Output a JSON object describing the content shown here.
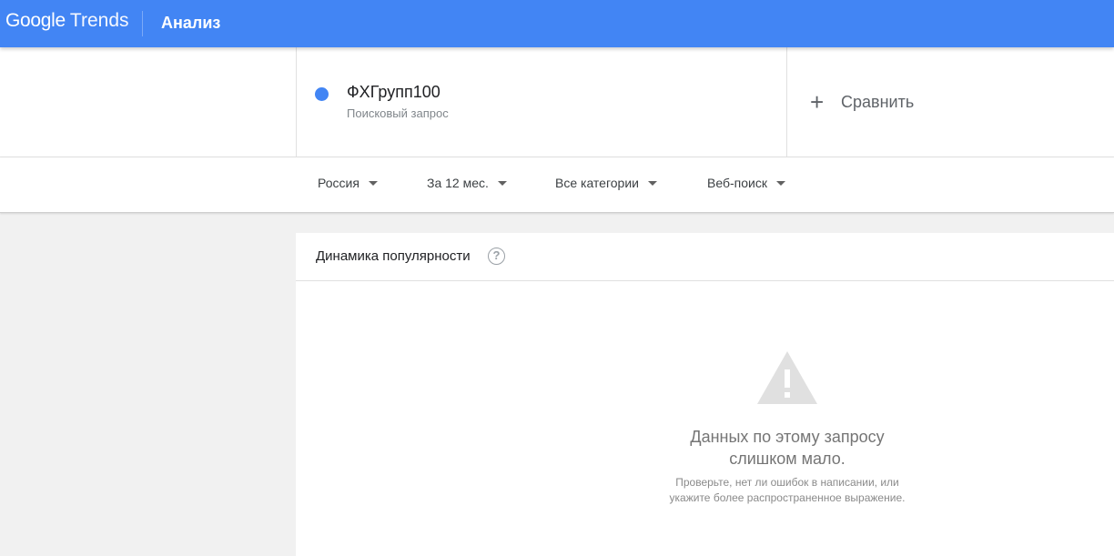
{
  "header": {
    "logo_google": "Google",
    "logo_trends": "Trends",
    "section_title": "Анализ"
  },
  "search_term": {
    "name": "ФХГрупп100",
    "type": "Поисковый запрос",
    "color": "#4285f4"
  },
  "compare": {
    "label": "Сравнить",
    "icon": "plus-icon"
  },
  "filters": {
    "region": "Россия",
    "period": "За 12 мес.",
    "category": "Все категории",
    "search_type": "Веб-поиск"
  },
  "card": {
    "title": "Динамика популярности",
    "help_icon": "?",
    "message_line1": "Данных по этому запросу",
    "message_line2": "слишком мало.",
    "hint_line1": "Проверьте, нет ли ошибок в написании, или",
    "hint_line2": "укажите более распространенное выражение."
  },
  "colors": {
    "brand": "#4285f4",
    "warning_icon": "#e0e0e0"
  }
}
